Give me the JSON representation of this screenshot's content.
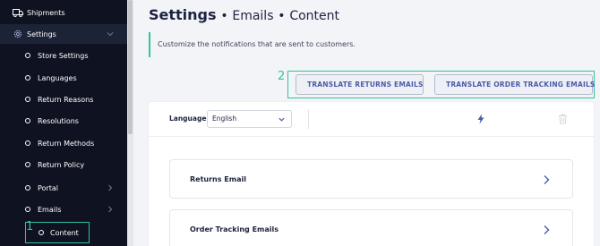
{
  "sidebar": {
    "shipments_label": "Shipments",
    "settings_label": "Settings",
    "sub_items": [
      {
        "label": "Store Settings"
      },
      {
        "label": "Languages"
      },
      {
        "label": "Return Reasons"
      },
      {
        "label": "Resolutions"
      },
      {
        "label": "Return Methods"
      },
      {
        "label": "Return Policy"
      },
      {
        "label": "Portal"
      },
      {
        "label": "Emails"
      },
      {
        "label": "Content"
      }
    ],
    "icons": {
      "shipments": "truck-icon",
      "settings": "gear-icon"
    }
  },
  "annotations": {
    "step1": "1",
    "step2": "2"
  },
  "header": {
    "title": "Settings",
    "sep1": "•",
    "crumb1": "Emails",
    "sep2": "•",
    "crumb2": "Content"
  },
  "notice": {
    "text": "Customize the notifications that are sent to customers."
  },
  "actions": {
    "translate_returns": "TRANSLATE RETURNS EMAILS",
    "translate_tracking": "TRANSLATE ORDER TRACKING EMAILS"
  },
  "toolbar": {
    "language_label": "Language",
    "language_value": "English"
  },
  "email_list": [
    {
      "label": "Returns Email"
    },
    {
      "label": "Order Tracking Emails"
    }
  ],
  "colors": {
    "accent": "#2fc3a0",
    "sidebar_bg": "#0f1221",
    "button_text": "#4b5ba8"
  }
}
